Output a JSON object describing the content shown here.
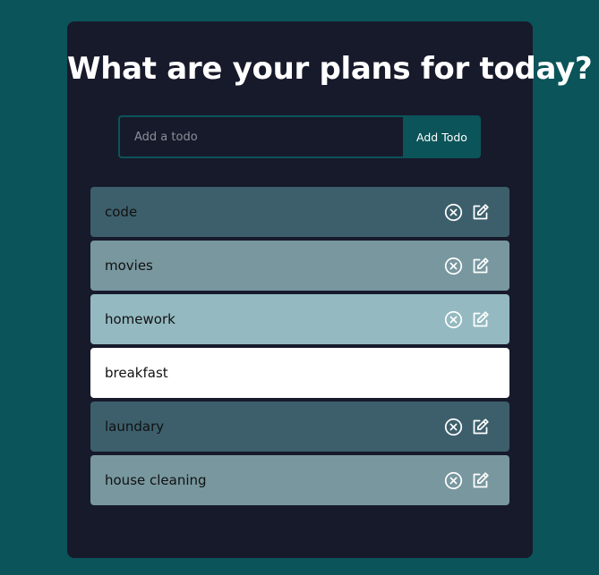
{
  "header": {
    "title": "What are your plans for today?"
  },
  "form": {
    "placeholder": "Add a todo",
    "value": "",
    "button_label": "Add Todo"
  },
  "todos": [
    {
      "text": "code",
      "color": "#3d5f6c",
      "show_actions": true
    },
    {
      "text": "movies",
      "color": "#78979f",
      "show_actions": true
    },
    {
      "text": "homework",
      "color": "#94b9c1",
      "show_actions": true
    },
    {
      "text": "breakfast",
      "color": "#ffffff",
      "show_actions": false
    },
    {
      "text": "laundary",
      "color": "#3d5f6c",
      "show_actions": true
    },
    {
      "text": "house cleaning",
      "color": "#78979f",
      "show_actions": true
    }
  ],
  "icons": {
    "delete": "close-circle-icon",
    "edit": "edit-icon"
  },
  "colors": {
    "page_background": "#0b5459",
    "card_background": "#171a2b",
    "accent": "#0b5459"
  }
}
